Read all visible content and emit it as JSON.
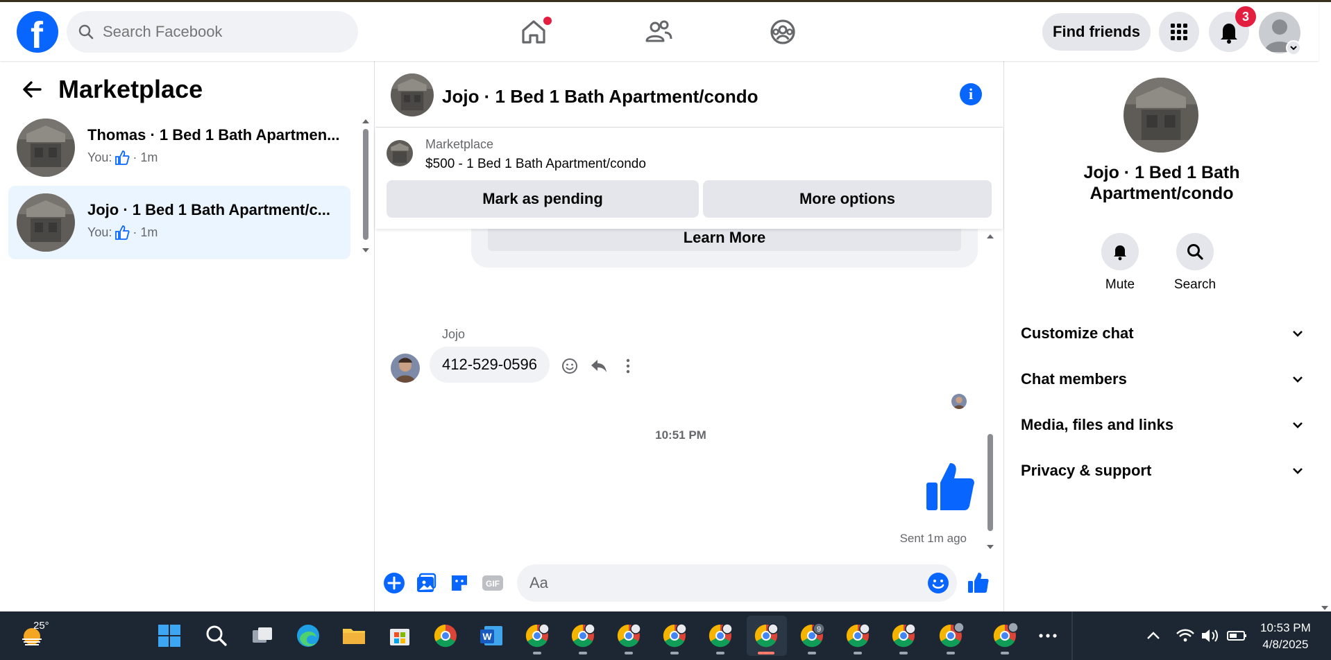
{
  "header": {
    "logo_letter": "f",
    "search_placeholder": "Search Facebook",
    "find_friends_label": "Find friends",
    "notification_count": "3"
  },
  "left_panel": {
    "title": "Marketplace",
    "conversations": [
      {
        "name": "Thomas · 1 Bed 1 Bath Apartmen...",
        "sub_prefix": "You:",
        "sub_time": "· 1m"
      },
      {
        "name": "Jojo · 1 Bed 1 Bath Apartment/c...",
        "sub_prefix": "You:",
        "sub_time": "· 1m",
        "active": true
      }
    ]
  },
  "chat": {
    "title": "Jojo · 1 Bed 1 Bath Apartment/condo",
    "listing": {
      "category": "Marketplace",
      "title": "$500 - 1 Bed 1 Bath Apartment/condo",
      "mark_pending_label": "Mark as pending",
      "more_options_label": "More options"
    },
    "learn_more_label": "Learn More",
    "sender_name": "Jojo",
    "message_text": "412-529-0596",
    "timestamp": "10:51 PM",
    "sent_status": "Sent 1m ago",
    "composer_placeholder": "Aa"
  },
  "right_panel": {
    "name": "Jojo · 1 Bed 1 Bath Apartment/condo",
    "mute_label": "Mute",
    "search_label": "Search",
    "sections": [
      "Customize chat",
      "Chat members",
      "Media, files and links",
      "Privacy & support"
    ]
  },
  "taskbar": {
    "temperature": "25°",
    "time": "10:53 PM",
    "date": "4/8/2025",
    "chrome_badge": "9"
  },
  "colors": {
    "brand_blue": "#0866ff",
    "badge_red": "#e41e3f",
    "active_conv": "#ebf5ff"
  }
}
